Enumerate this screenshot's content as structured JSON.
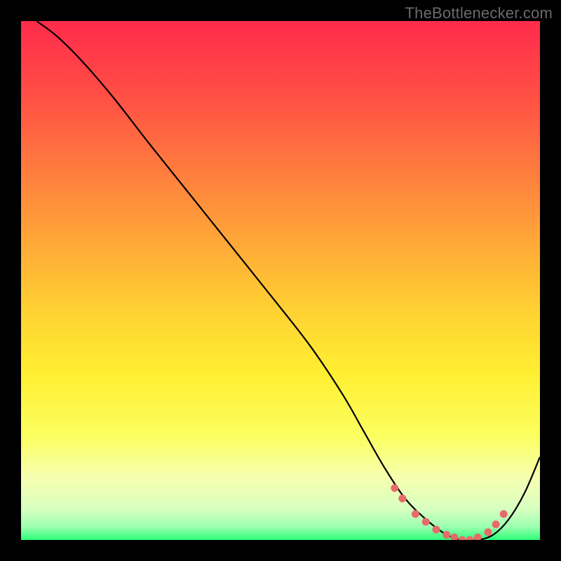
{
  "watermark": "TheBottlenecker.com",
  "colors": {
    "background": "#000000",
    "curve": "#000000",
    "dots": "#e86b6b",
    "gradient_stops": [
      {
        "offset": 0.0,
        "color": "#ff2b4b"
      },
      {
        "offset": 0.14,
        "color": "#ff4e45"
      },
      {
        "offset": 0.28,
        "color": "#ff7a3f"
      },
      {
        "offset": 0.42,
        "color": "#ffa638"
      },
      {
        "offset": 0.56,
        "color": "#ffd232"
      },
      {
        "offset": 0.68,
        "color": "#ffef32"
      },
      {
        "offset": 0.8,
        "color": "#fbff60"
      },
      {
        "offset": 0.88,
        "color": "#f6ffb0"
      },
      {
        "offset": 0.94,
        "color": "#d8ffc0"
      },
      {
        "offset": 0.975,
        "color": "#9bffb0"
      },
      {
        "offset": 1.0,
        "color": "#2cff78"
      }
    ]
  },
  "chart_data": {
    "type": "line",
    "title": "",
    "xlabel": "",
    "ylabel": "",
    "xlim": [
      0,
      100
    ],
    "ylim": [
      0,
      100
    ],
    "x": [
      3,
      7,
      12,
      18,
      25,
      33,
      41,
      49,
      56,
      62,
      66,
      70,
      74,
      78,
      82,
      85,
      88,
      91,
      94,
      97,
      100
    ],
    "values": [
      100,
      97,
      92,
      85,
      76,
      66,
      56,
      46,
      37,
      28,
      21,
      14,
      8,
      4,
      1,
      0,
      0,
      1,
      4,
      9,
      16
    ],
    "highlight_region": {
      "x_start": 72,
      "x_end": 93
    },
    "dots": [
      {
        "x": 72,
        "y": 10
      },
      {
        "x": 73.5,
        "y": 8
      },
      {
        "x": 76,
        "y": 5
      },
      {
        "x": 78,
        "y": 3.5
      },
      {
        "x": 80,
        "y": 2
      },
      {
        "x": 82,
        "y": 1
      },
      {
        "x": 83.5,
        "y": 0.5
      },
      {
        "x": 85,
        "y": 0
      },
      {
        "x": 86.5,
        "y": 0
      },
      {
        "x": 88,
        "y": 0.5
      },
      {
        "x": 90,
        "y": 1.5
      },
      {
        "x": 91.5,
        "y": 3
      },
      {
        "x": 93,
        "y": 5
      }
    ]
  }
}
